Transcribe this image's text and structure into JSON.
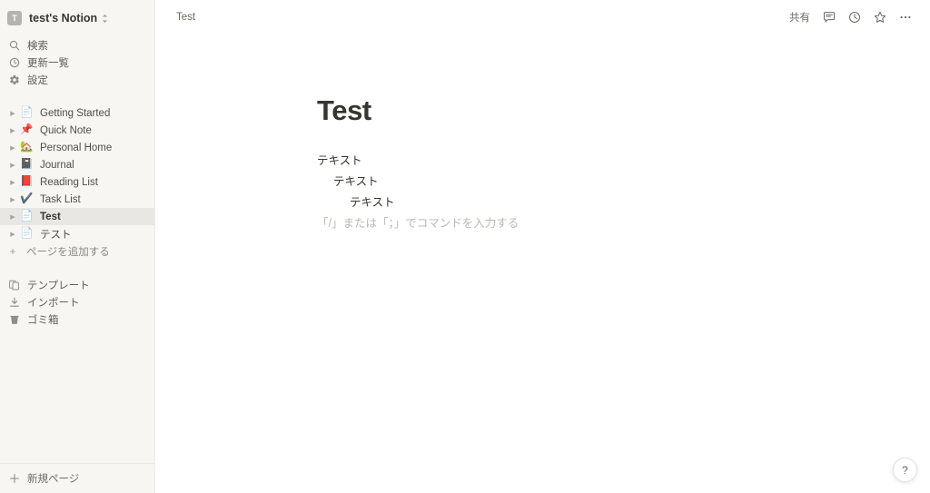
{
  "workspace": {
    "avatar_letter": "T",
    "name": "test's Notion"
  },
  "sidebar": {
    "nav": [
      {
        "icon": "search-icon",
        "label": "検索"
      },
      {
        "icon": "clock-icon",
        "label": "更新一覧"
      },
      {
        "icon": "gear-icon",
        "label": "設定"
      }
    ],
    "pages": [
      {
        "emoji": "📄",
        "label": "Getting Started",
        "selected": false
      },
      {
        "emoji": "📌",
        "label": "Quick Note",
        "selected": false
      },
      {
        "emoji": "🏡",
        "label": "Personal Home",
        "selected": false
      },
      {
        "emoji": "📓",
        "label": "Journal",
        "selected": false
      },
      {
        "emoji": "📕",
        "label": "Reading List",
        "selected": false
      },
      {
        "emoji": "✔️",
        "label": "Task List",
        "selected": false
      },
      {
        "emoji": "📄",
        "label": "Test",
        "selected": true
      },
      {
        "emoji": "📄",
        "label": "テスト",
        "selected": false
      }
    ],
    "add_page_label": "ページを追加する",
    "tools": [
      {
        "icon": "template-icon",
        "label": "テンプレート"
      },
      {
        "icon": "import-icon",
        "label": "インポート"
      },
      {
        "icon": "trash-icon",
        "label": "ゴミ箱"
      }
    ],
    "new_page_label": "新規ページ"
  },
  "topbar": {
    "breadcrumb": "Test",
    "share_label": "共有",
    "icons": [
      {
        "name": "comment-icon"
      },
      {
        "name": "history-icon"
      },
      {
        "name": "favorite-star-icon"
      },
      {
        "name": "more-options-icon"
      }
    ]
  },
  "document": {
    "title": "Test",
    "blocks": [
      {
        "text": "テキスト",
        "indent": 0
      },
      {
        "text": "テキスト",
        "indent": 1
      },
      {
        "text": "テキスト",
        "indent": 2
      }
    ],
    "placeholder": "「/」または「；」でコマンドを入力する"
  },
  "help": {
    "label": "?"
  },
  "colors": {
    "sidebar_bg": "#f7f6f3",
    "main_bg": "#ffffff",
    "text": "#37352f",
    "muted": "#9b9a97",
    "selected_row": "#e8e7e3"
  }
}
